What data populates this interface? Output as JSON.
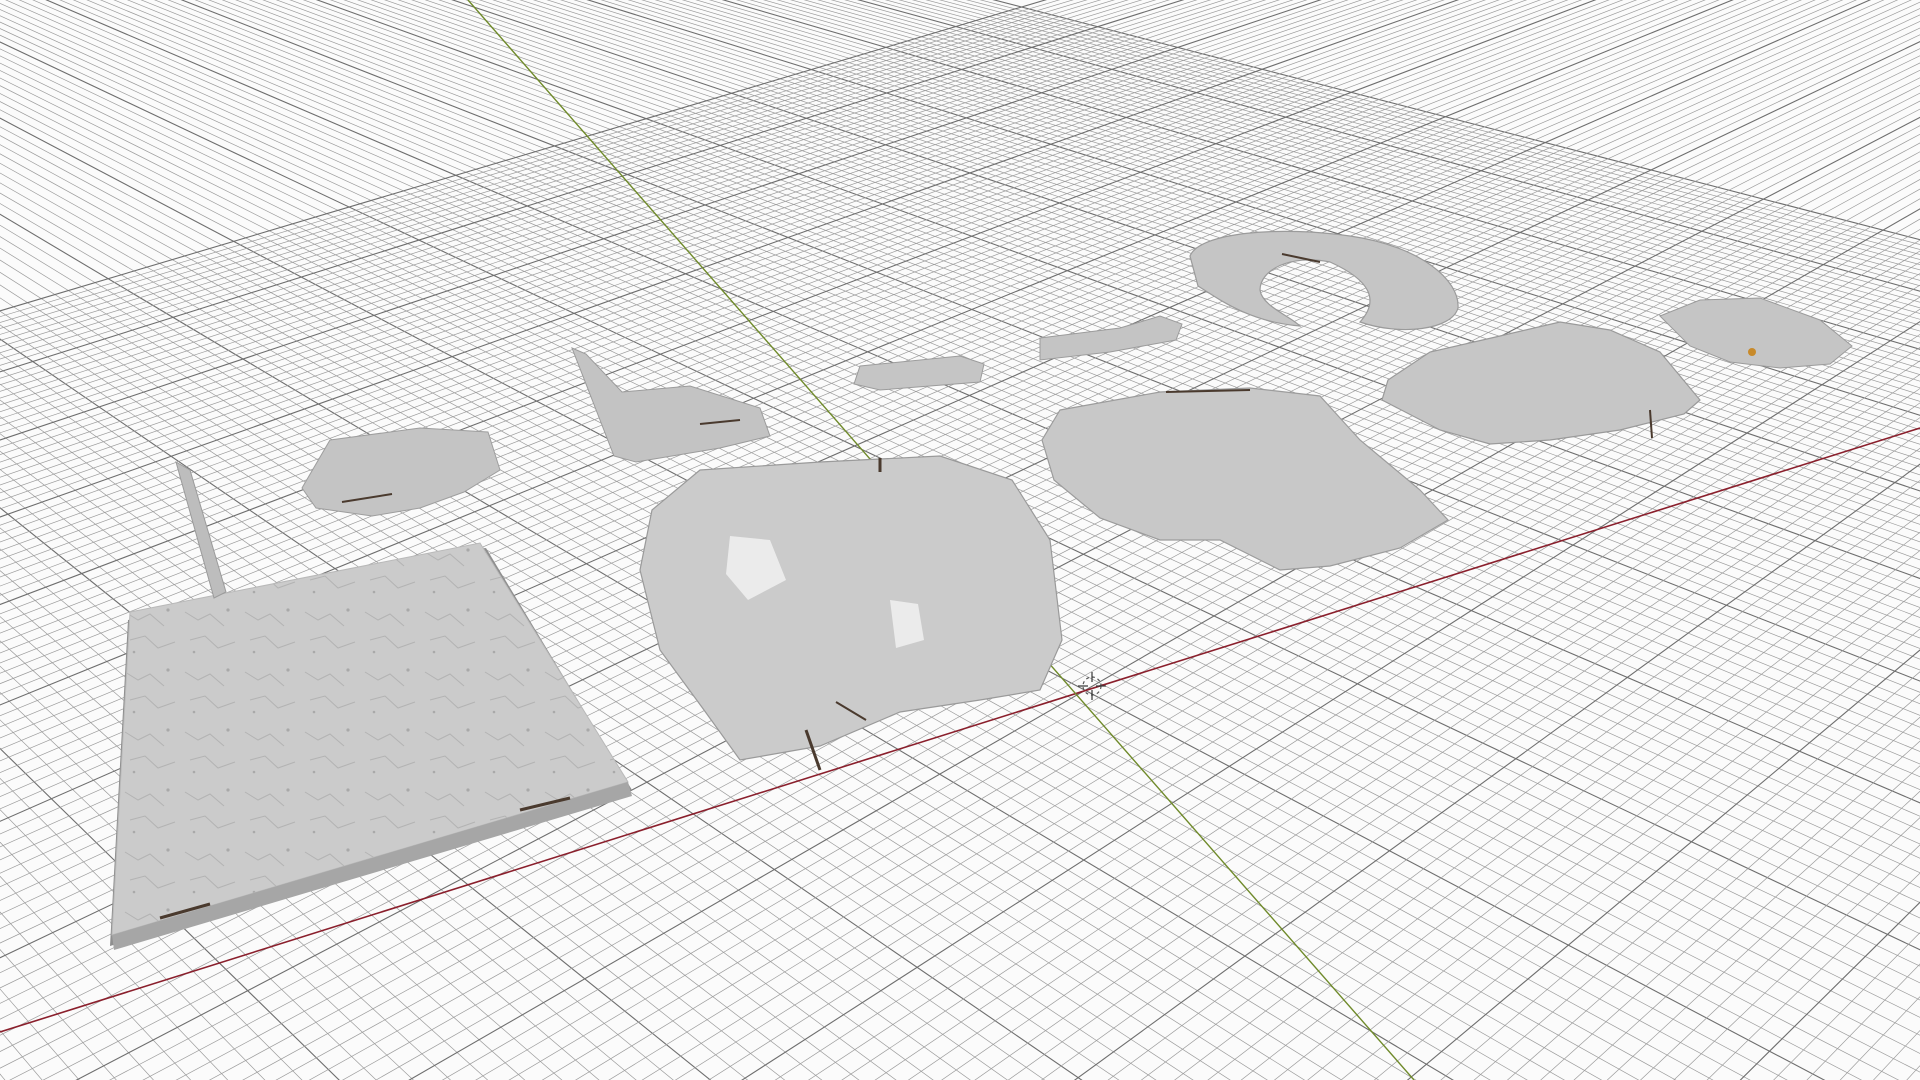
{
  "viewport": {
    "background": "#fbfbfb",
    "grid_color": "#9c9c9c",
    "grid_major_color": "#6e6e6e",
    "x_axis_color": "#8a1f2c",
    "y_axis_color": "#6f8a2a",
    "mesh_color": "#c9c9c9",
    "mesh_shadow": "#9a9a9a",
    "rebar_color": "#4a3a2e"
  },
  "scene": {
    "objects": [
      {
        "name": "slab-large-square"
      },
      {
        "name": "wall-fragment-left"
      },
      {
        "name": "slab-small-rubble"
      },
      {
        "name": "wall-corner-fragment"
      },
      {
        "name": "slab-large-broken"
      },
      {
        "name": "beam-fragment-small"
      },
      {
        "name": "beam-fragment-long"
      },
      {
        "name": "slab-ring-broken"
      },
      {
        "name": "slab-center-broken"
      },
      {
        "name": "slab-right-broken"
      },
      {
        "name": "slab-far-right-small"
      }
    ]
  },
  "cursor": {
    "icon": "3d-cursor-icon"
  }
}
